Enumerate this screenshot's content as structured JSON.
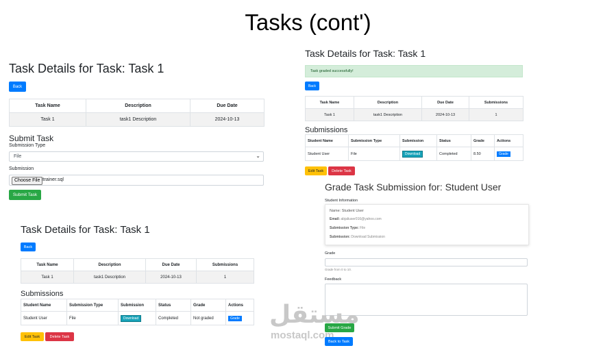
{
  "slide": {
    "title": "Tasks (cont')"
  },
  "panel1": {
    "title": "Task Details for Task: Task 1",
    "back": "Back",
    "headers": [
      "Task Name",
      "Description",
      "Due Date"
    ],
    "row": [
      "Task 1",
      "task1 Description",
      "2024-10-13"
    ],
    "submit_title": "Submit Task",
    "submission_type_label": "Submission Type",
    "submission_type_value": "File",
    "submission_label": "Submission",
    "choose_file": "Choose File",
    "file_name": "itrainer.sql",
    "submit_button": "Submit Task"
  },
  "panel2": {
    "title": "Task Details for Task: Task 1",
    "back": "Back",
    "headers": [
      "Task Name",
      "Description",
      "Due Date",
      "Submissions"
    ],
    "row": [
      "Task 1",
      "task1 Description",
      "2024-10-13",
      "1"
    ],
    "submissions_title": "Submissions",
    "sub_headers": [
      "Student Name",
      "Submission Type",
      "Submission",
      "Status",
      "Grade",
      "Actions"
    ],
    "sub_row": {
      "student": "Student User",
      "type": "File",
      "download": "Download",
      "status": "Completed",
      "grade": "Not graded",
      "action": "Grade"
    },
    "edit": "Edit Task",
    "delete": "Delete Task"
  },
  "panel3": {
    "title": "Task Details for Task: Task 1",
    "alert": "Task graded successfully!",
    "back": "Back",
    "headers": [
      "Task Name",
      "Description",
      "Due Date",
      "Submissions"
    ],
    "row": [
      "Task 1",
      "task1 Description",
      "2024-10-13",
      "1"
    ],
    "submissions_title": "Submissions",
    "sub_headers": [
      "Student Name",
      "Submission Type",
      "Submission",
      "Status",
      "Grade",
      "Actions"
    ],
    "sub_row": {
      "student": "Student User",
      "type": "File",
      "download": "Download",
      "status": "Completed",
      "grade": "8.50",
      "action": "Grade"
    },
    "edit": "Edit Task",
    "delete": "Delete Task"
  },
  "panel4": {
    "title": "Grade Task Submission for: Student User",
    "info_title": "Student Information",
    "name_line": "Name: Student User",
    "email_label": "Email:",
    "email_value": "abjaliuser016@yahoo.com",
    "type_label": "Submission Type:",
    "type_value": "File",
    "submission_label": "Submission:",
    "submission_value": "Download Submission",
    "grade_label": "Grade",
    "grade_hint": "Grade from 0 to 10.",
    "feedback_label": "Feedback",
    "submit_grade": "Submit Grade",
    "back_to_task": "Back to Task"
  },
  "watermark": {
    "arabic": "مستقل",
    "latin": "mostaql.com"
  }
}
